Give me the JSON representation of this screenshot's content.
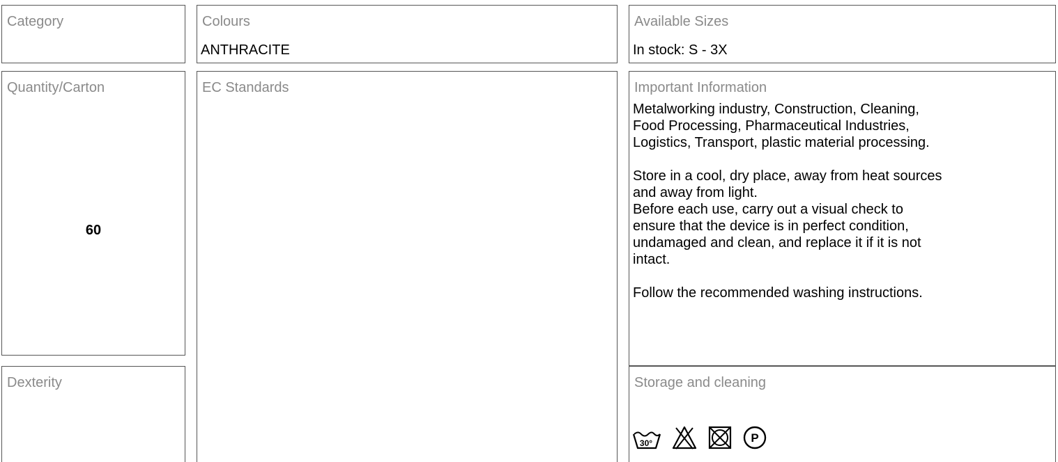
{
  "category": {
    "label": "Category",
    "value": ""
  },
  "colours": {
    "label": "Colours",
    "value": "ANTHRACITE"
  },
  "available_sizes": {
    "label": "Available Sizes",
    "value": "In stock: S - 3X"
  },
  "quantity_carton": {
    "label": "Quantity/Carton",
    "value": "60"
  },
  "ec_standards": {
    "label": "EC Standards",
    "value": ""
  },
  "important_information": {
    "label": "Important Information",
    "paragraphs": [
      [
        "Metalworking industry, Construction, Cleaning,",
        "Food Processing, Pharmaceutical Industries,",
        "Logistics, Transport, plastic material processing."
      ],
      [
        "Store in a cool, dry place, away from heat sources",
        "and away from light.",
        "Before each use, carry out a visual check to",
        "ensure that the device is in perfect condition,",
        "undamaged and clean, and replace it if it is not",
        "intact."
      ],
      [
        "Follow the recommended washing instructions."
      ]
    ]
  },
  "dexterity": {
    "label": "Dexterity",
    "value": ""
  },
  "storage_cleaning": {
    "label": "Storage and cleaning",
    "icons": [
      "wash-30-icon",
      "do-not-bleach-icon",
      "do-not-tumble-dry-icon",
      "professional-dry-clean-p-icon"
    ],
    "wash_temperature": "30°",
    "dry_clean_letter": "P"
  }
}
